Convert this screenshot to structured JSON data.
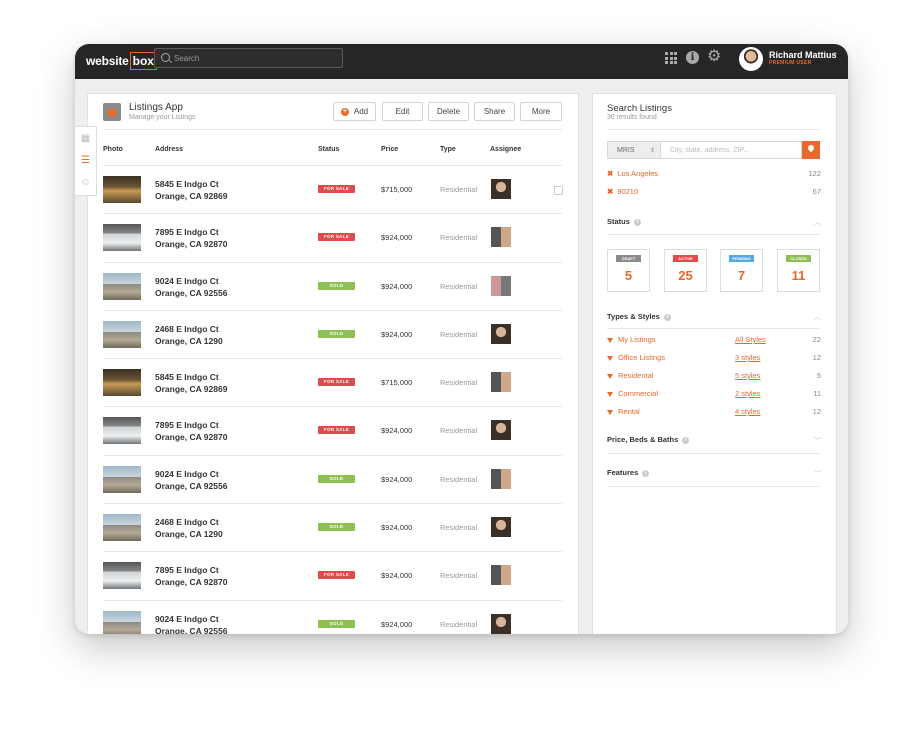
{
  "header": {
    "logo_word": "website",
    "logo_box": "box",
    "search_placeholder": "Search",
    "user_name": "Richard Mattius",
    "user_role": "PREMIUM USER"
  },
  "app": {
    "title": "Listings App",
    "subtitle": "Manage your Listings",
    "buttons": {
      "add": "Add",
      "edit": "Edit",
      "delete": "Delete",
      "share": "Share",
      "more": "More"
    },
    "columns": {
      "photo": "Photo",
      "address": "Address",
      "status": "Status",
      "price": "Price",
      "type": "Type",
      "assignee": "Assignee"
    }
  },
  "listings": [
    {
      "addr1": "5845 E Indgo Ct",
      "addr2": "Orange, CA 92869",
      "status": "FOR SALE",
      "price": "$715,000",
      "type": "Residential"
    },
    {
      "addr1": "7895 E Indgo Ct",
      "addr2": "Orange, CA 92870",
      "status": "FOR SALE",
      "price": "$924,000",
      "type": "Residential"
    },
    {
      "addr1": "9024 E Indgo Ct",
      "addr2": "Orange, CA 92556",
      "status": "SOLD",
      "price": "$924,000",
      "type": "Residential"
    },
    {
      "addr1": "2468 E Indgo Ct",
      "addr2": "Orange, CA 1290",
      "status": "SOLD",
      "price": "$924,000",
      "type": "Residential"
    },
    {
      "addr1": "5845 E Indgo Ct",
      "addr2": "Orange, CA 92869",
      "status": "FOR SALE",
      "price": "$715,000",
      "type": "Residential"
    },
    {
      "addr1": "7895 E Indgo Ct",
      "addr2": "Orange, CA 92870",
      "status": "FOR SALE",
      "price": "$924,000",
      "type": "Residential"
    },
    {
      "addr1": "9024 E Indgo Ct",
      "addr2": "Orange, CA 92556",
      "status": "SOLD",
      "price": "$924,000",
      "type": "Residential"
    },
    {
      "addr1": "2468 E Indgo Ct",
      "addr2": "Orange, CA 1290",
      "status": "SOLD",
      "price": "$924,000",
      "type": "Residential"
    },
    {
      "addr1": "7895 E Indgo Ct",
      "addr2": "Orange, CA 92870",
      "status": "FOR SALE",
      "price": "$924,000",
      "type": "Residential"
    },
    {
      "addr1": "9024 E Indgo Ct",
      "addr2": "Orange, CA 92556",
      "status": "SOLD",
      "price": "$924,000",
      "type": "Residential"
    }
  ],
  "search_panel": {
    "title": "Search Listings",
    "results": "30 results found",
    "source": "MRIS",
    "location_placeholder": "City, state, address, ZIP...",
    "tags": [
      {
        "label": "Los Angeles",
        "count": "122"
      },
      {
        "label": "90210",
        "count": "67"
      }
    ],
    "status_title": "Status",
    "statuses": [
      {
        "label": "DRAFT",
        "count": "5",
        "color": "#8a8a8a"
      },
      {
        "label": "ACTIVE",
        "count": "25",
        "color": "#e04b4b"
      },
      {
        "label": "PENDING",
        "count": "7",
        "color": "#5aa7e0"
      },
      {
        "label": "CLOSED",
        "count": "11",
        "color": "#8cc152"
      }
    ],
    "types_title": "Types & Styles",
    "types": [
      {
        "label": "My Listings",
        "link": "All Styles",
        "count": "22"
      },
      {
        "label": "Office Listings",
        "link": "3 styles",
        "count": "12"
      },
      {
        "label": "Residental",
        "link": "5 styles",
        "count": "5"
      },
      {
        "label": "Commercial",
        "link": "2 styles",
        "count": "11"
      },
      {
        "label": "Rental",
        "link": "4 styles",
        "count": "12"
      }
    ],
    "price_title": "Price, Beds & Baths",
    "features_title": "Features"
  },
  "colors": {
    "accent": "#e8692a",
    "for_sale": "#e04b4b",
    "sold": "#8cc152",
    "topbar": "#262626"
  }
}
